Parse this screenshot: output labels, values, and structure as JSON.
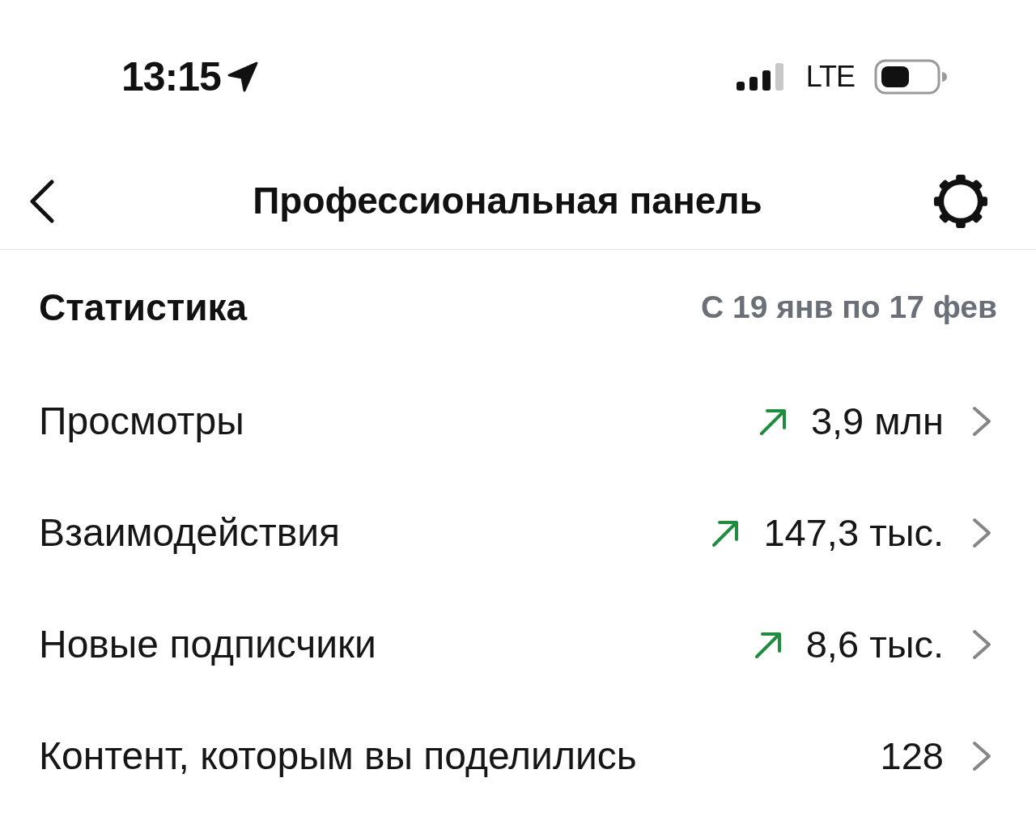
{
  "status_bar": {
    "time": "13:15",
    "network": "LTE"
  },
  "header": {
    "title": "Профессиональная панель"
  },
  "statistics": {
    "title": "Статистика",
    "period": "С 19 янв по 17 фев",
    "rows": [
      {
        "label": "Просмотры",
        "value": "3,9 млн",
        "rising": true
      },
      {
        "label": "Взаимодействия",
        "value": "147,3 тыс.",
        "rising": true
      },
      {
        "label": "Новые подписчики",
        "value": "8,6 тыс.",
        "rising": true
      },
      {
        "label": "Контент, которым вы поделились",
        "value": "128",
        "rising": false
      }
    ]
  }
}
